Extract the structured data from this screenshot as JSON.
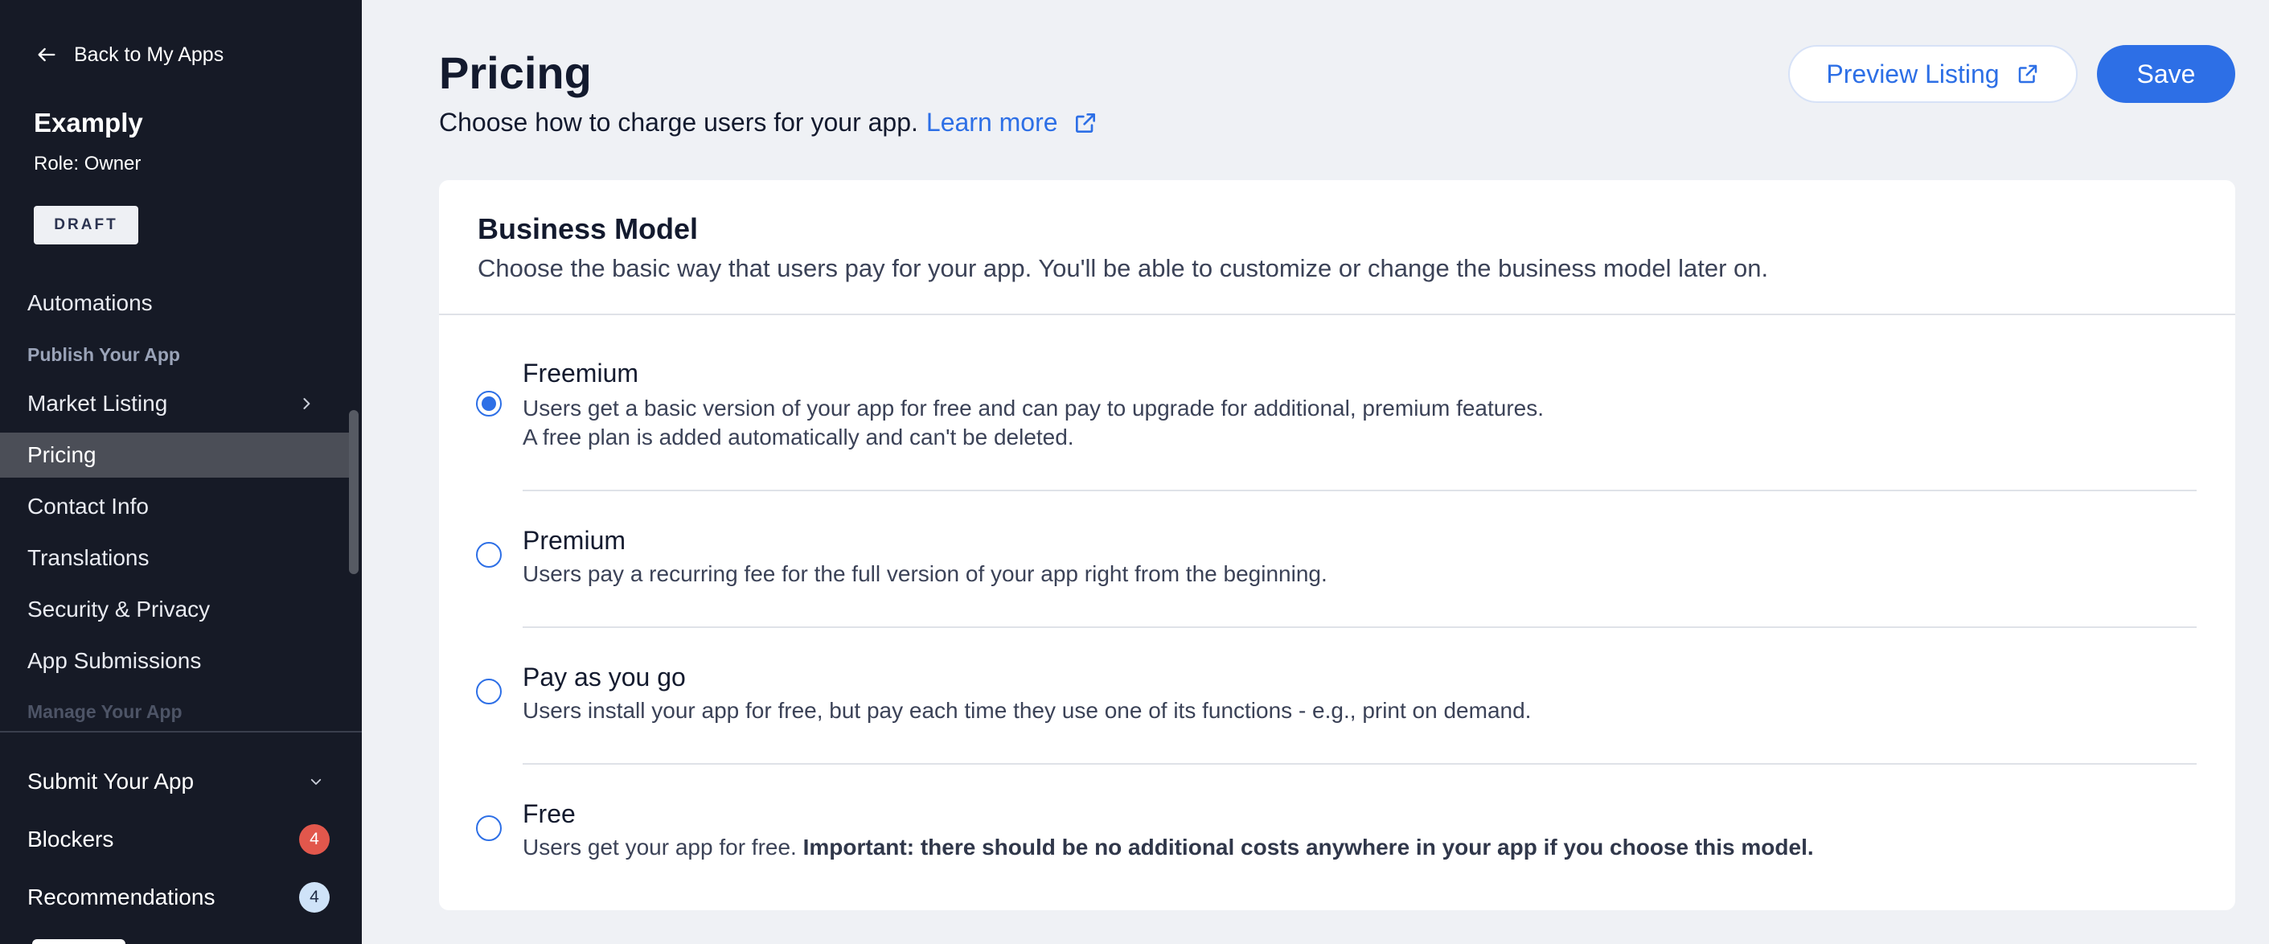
{
  "sidebar": {
    "back_label": "Back to My Apps",
    "app_name": "Examply",
    "role": "Role: Owner",
    "status_badge": "DRAFT",
    "items": [
      {
        "label": "Automations"
      },
      {
        "label": "Market Listing"
      },
      {
        "label": "Pricing"
      },
      {
        "label": "Contact Info"
      },
      {
        "label": "Translations"
      },
      {
        "label": "Security & Privacy"
      },
      {
        "label": "App Submissions"
      }
    ],
    "section_publish": "Publish Your App",
    "section_manage": "Manage Your App",
    "active_item": "Pricing",
    "bottom": {
      "submit_label": "Submit Your App",
      "blockers_label": "Blockers",
      "blockers_count": "4",
      "recommendations_label": "Recommendations",
      "recommendations_count": "4"
    }
  },
  "header": {
    "title": "Pricing",
    "subtitle": "Choose how to charge users for your app.",
    "learn_more": "Learn more",
    "preview_label": "Preview Listing",
    "save_label": "Save"
  },
  "business_model": {
    "title": "Business Model",
    "description": "Choose the basic way that users pay for your app. You'll be able to customize or change the business model later on.",
    "selected": "Freemium",
    "options": [
      {
        "title": "Freemium",
        "line1": "Users get a basic version of your app for free and can pay to upgrade for additional, premium features.",
        "line2": "A free plan is added automatically and can't be deleted."
      },
      {
        "title": "Premium",
        "line1": "Users pay a recurring fee for the full version of your app right from the beginning."
      },
      {
        "title": "Pay as you go",
        "line1": "Users install your app for free, but pay each time they use one of its functions - e.g., print on demand."
      },
      {
        "title": "Free",
        "line1": "Users get your app for free.",
        "line1_bold": "Important: there should be no additional costs anywhere in your app if you choose this model."
      }
    ]
  },
  "colors": {
    "sidebar_bg": "#161a26",
    "accent": "#2d6fe6",
    "page_bg": "#eff1f5",
    "badge_red": "#e2574c",
    "badge_blue": "#cfe3f8"
  }
}
